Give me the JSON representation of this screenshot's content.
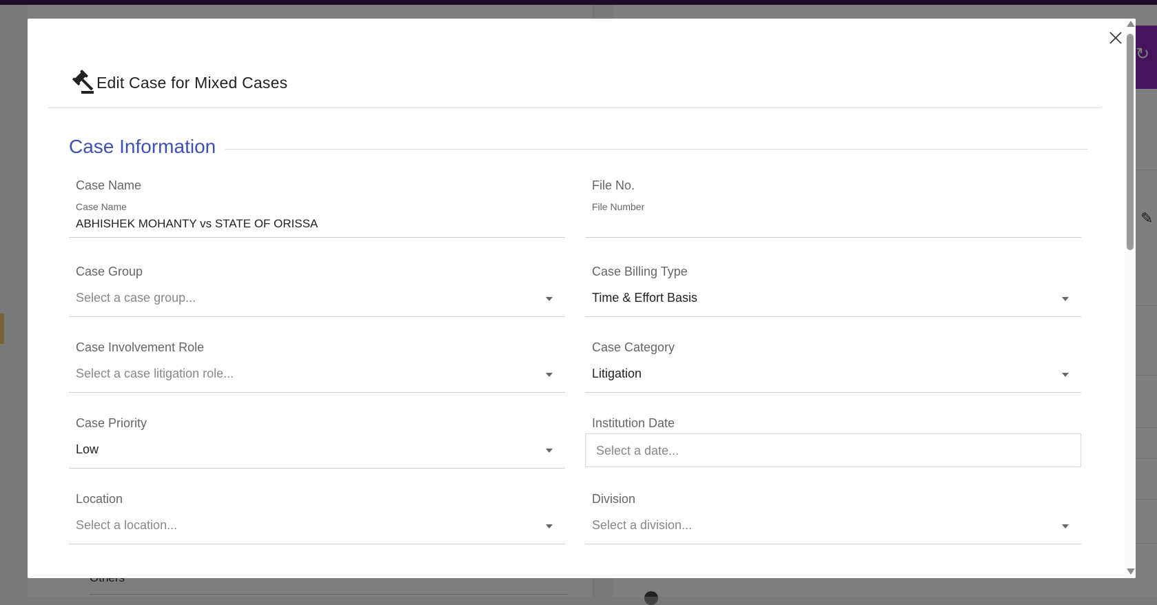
{
  "modal": {
    "title": "Edit Case for Mixed Cases",
    "section_title": "Case Information"
  },
  "fields": {
    "case_name": {
      "label": "Case Name",
      "sublabel": "Case Name",
      "value": "ABHISHEK MOHANTY vs STATE OF ORISSA"
    },
    "file_no": {
      "label": "File No.",
      "sublabel": "File Number",
      "value": ""
    },
    "case_group": {
      "label": "Case Group",
      "placeholder": "Select a case group..."
    },
    "case_billing_type": {
      "label": "Case Billing Type",
      "selected": "Time & Effort Basis"
    },
    "case_involvement_role": {
      "label": "Case Involvement Role",
      "placeholder": "Select a case litigation role..."
    },
    "case_category": {
      "label": "Case Category",
      "selected": "Litigation"
    },
    "case_priority": {
      "label": "Case Priority",
      "selected": "Low"
    },
    "institution_date": {
      "label": "Institution Date",
      "placeholder": "Select a date..."
    },
    "location": {
      "label": "Location",
      "placeholder": "Select a location..."
    },
    "division": {
      "label": "Division",
      "placeholder": "Select a division..."
    }
  },
  "background": {
    "others_label": "Others"
  },
  "colors": {
    "accent": "#3f51b5",
    "topbar": "#3d1a57",
    "purple_button": "#8a2bb6"
  },
  "icons": {
    "header": "gavel-icon",
    "close": "close-icon",
    "dropdown": "chevron-down-icon",
    "bg_refresh": "refresh-icon",
    "bg_edit": "pencil-icon"
  }
}
